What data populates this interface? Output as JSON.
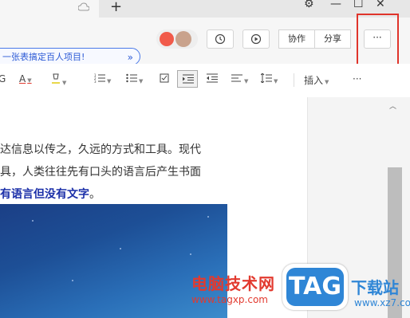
{
  "tabbar": {
    "new_tab": "+"
  },
  "window": {
    "settings": "⚙",
    "minimize": "—",
    "restore": "☐",
    "close": "✕"
  },
  "toolbar": {
    "banner_text": "一张表搞定百人项目!",
    "banner_chev": "»",
    "collab_label": "协作",
    "share_label": "分享",
    "more_label": "···"
  },
  "format": {
    "bold": "G",
    "font_color": "A",
    "insert_label": "插入",
    "more": "···"
  },
  "doc": {
    "line1": "达信息以传之，久远的方式和工具。现代",
    "line2": "具，人类往往先有口头的语言后产生书面",
    "line3_blue": "有语言但没有文字",
    "line3_end": "。"
  },
  "watermark": {
    "site_cn": "电脑技术网",
    "site_url": "www.tagxp.com",
    "logo": "TAG",
    "dl_cn": "下载站",
    "dl_url": "www.xz7.com"
  }
}
